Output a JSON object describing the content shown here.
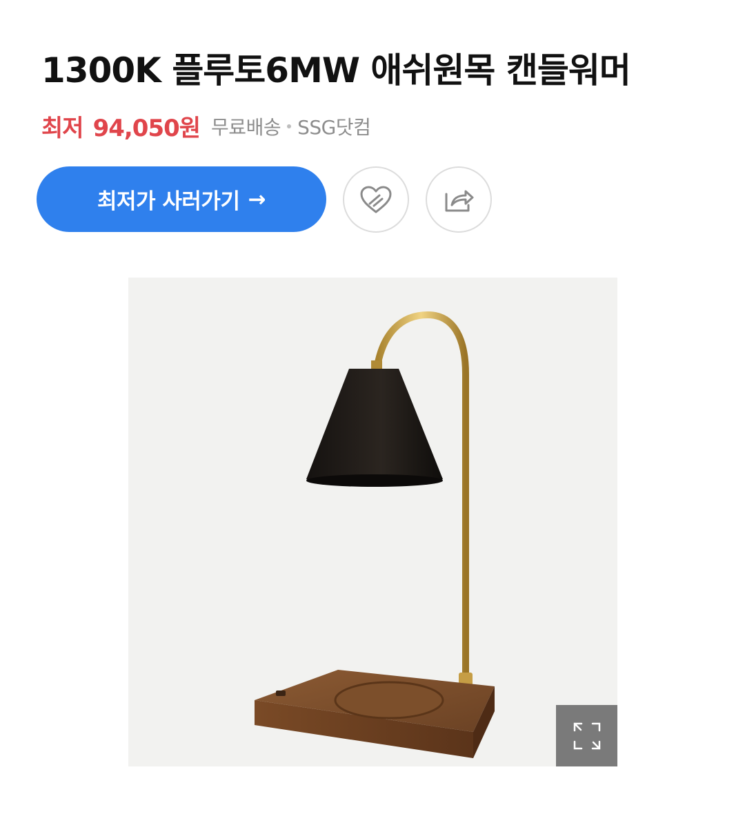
{
  "product": {
    "title": "1300K 플루토6MW 애쉬원목 캔들워머",
    "price_label": "최저",
    "price_value": "94,050원",
    "shipping": "무료배송",
    "seller": "SSG닷컴",
    "image_alt": "캔들워머 램프 이미지"
  },
  "actions": {
    "buy_label": "최저가 사러가기",
    "buy_arrow": "→",
    "like_icon": "heart-outline-icon",
    "share_icon": "share-icon",
    "expand_icon": "expand-icon"
  },
  "colors": {
    "accent_blue": "#2f80ed",
    "price_red": "#e0454b",
    "muted_text": "#8d8d8d"
  }
}
